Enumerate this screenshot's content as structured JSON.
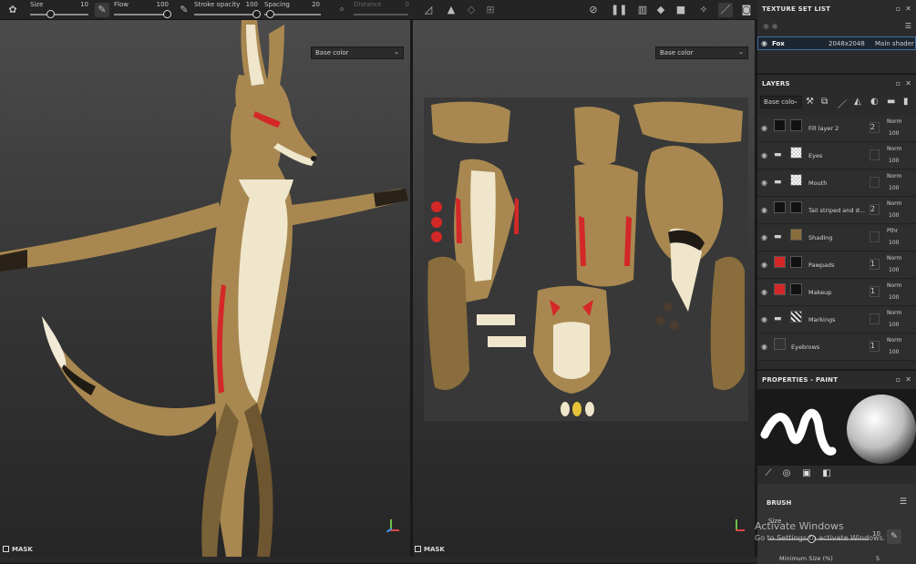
{
  "toolbar": {
    "size_label": "Size",
    "size_value": "10",
    "flow_label": "Flow",
    "flow_value": "100",
    "stroke_opacity_label": "Stroke opacity",
    "stroke_opacity_value": "100",
    "spacing_label": "Spacing",
    "spacing_value": "20",
    "distance_label": "Distance",
    "distance_value": "0"
  },
  "viewport_3d": {
    "channel": "Base color",
    "mask_label": "MASK"
  },
  "viewport_2d": {
    "channel": "Base color",
    "mask_label": "MASK"
  },
  "texture_set_list": {
    "title": "TEXTURE SET LIST",
    "set": {
      "name": "Fox",
      "resolution": "2048x2048",
      "shader": "Main shader"
    }
  },
  "layers": {
    "title": "LAYERS",
    "channel": "Base colo",
    "items": [
      {
        "name": "Fill layer 2",
        "blend": "Norm",
        "opacity": "100",
        "count": "2"
      },
      {
        "name": "Eyes",
        "blend": "Norm",
        "opacity": "100",
        "count": ""
      },
      {
        "name": "Mouth",
        "blend": "Norm",
        "opacity": "100",
        "count": ""
      },
      {
        "name": "Tail striped and d...",
        "blend": "Norm",
        "opacity": "100",
        "count": "2"
      },
      {
        "name": "Shading",
        "blend": "Pthr",
        "opacity": "100",
        "count": ""
      },
      {
        "name": "Pawpads",
        "blend": "Norm",
        "opacity": "100",
        "count": "1"
      },
      {
        "name": "Makeup",
        "blend": "Norm",
        "opacity": "100",
        "count": "1"
      },
      {
        "name": "Markings",
        "blend": "Norm",
        "opacity": "100",
        "count": ""
      },
      {
        "name": "Eyebrows",
        "blend": "Norm",
        "opacity": "100",
        "count": "1"
      }
    ]
  },
  "properties": {
    "title": "PROPERTIES - PAINT",
    "brush_label": "BRUSH",
    "size_label": "Size",
    "size_value": "10",
    "min_size_label": "Minimum Size (%)",
    "min_size_value": "5"
  },
  "watermark": {
    "line1": "Activate Windows",
    "line2": "Go to Settings to activate Windows."
  }
}
